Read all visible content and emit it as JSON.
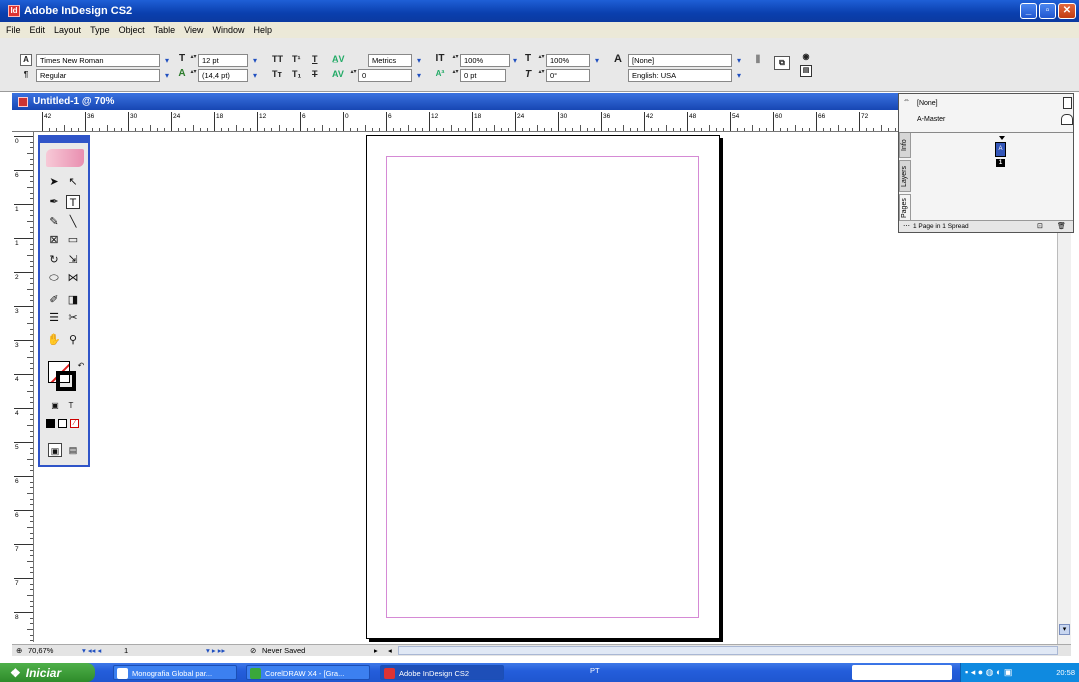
{
  "window": {
    "title": "Adobe InDesign CS2"
  },
  "menu": [
    "File",
    "Edit",
    "Layout",
    "Type",
    "Object",
    "Table",
    "View",
    "Window",
    "Help"
  ],
  "control": {
    "font_family": "Times New Roman",
    "font_style": "Regular",
    "font_size": "12 pt",
    "leading": "(14,4 pt)",
    "kerning": "Metrics",
    "tracking": "0",
    "vertical_scale": "100%",
    "horizontal_scale": "100%",
    "baseline_shift": "0 pt",
    "skew": "0°",
    "char_style": "[None]",
    "language": "English: USA"
  },
  "document": {
    "title": "Untitled-1 @ 70%",
    "zoom": "70,67%",
    "page_number": "1",
    "status": "Never Saved"
  },
  "ruler": {
    "h_ticks": [
      "42",
      "36",
      "30",
      "24",
      "18",
      "12",
      "6",
      "0",
      "6",
      "12",
      "18",
      "24",
      "30",
      "36",
      "42",
      "48",
      "54",
      "60",
      "66",
      "72"
    ],
    "v_ticks": [
      "0",
      "6",
      "1",
      "1",
      "2",
      "3",
      "3",
      "4",
      "4",
      "5",
      "6",
      "6",
      "7",
      "7",
      "8"
    ]
  },
  "pages_panel": {
    "tabs": [
      "Pages",
      "Layers",
      "Info"
    ],
    "none_label": "[None]",
    "master_label": "A-Master",
    "thumb_letter": "A",
    "page_label": "1",
    "footer": "1 Page in 1 Spread"
  },
  "taskbar": {
    "start": "Iniciar",
    "tasks": [
      "Monografia Global par...",
      "CorelDRAW X4 - [Gra...",
      "Adobe InDesign CS2"
    ],
    "lang": "PT",
    "clock": "20:58"
  }
}
